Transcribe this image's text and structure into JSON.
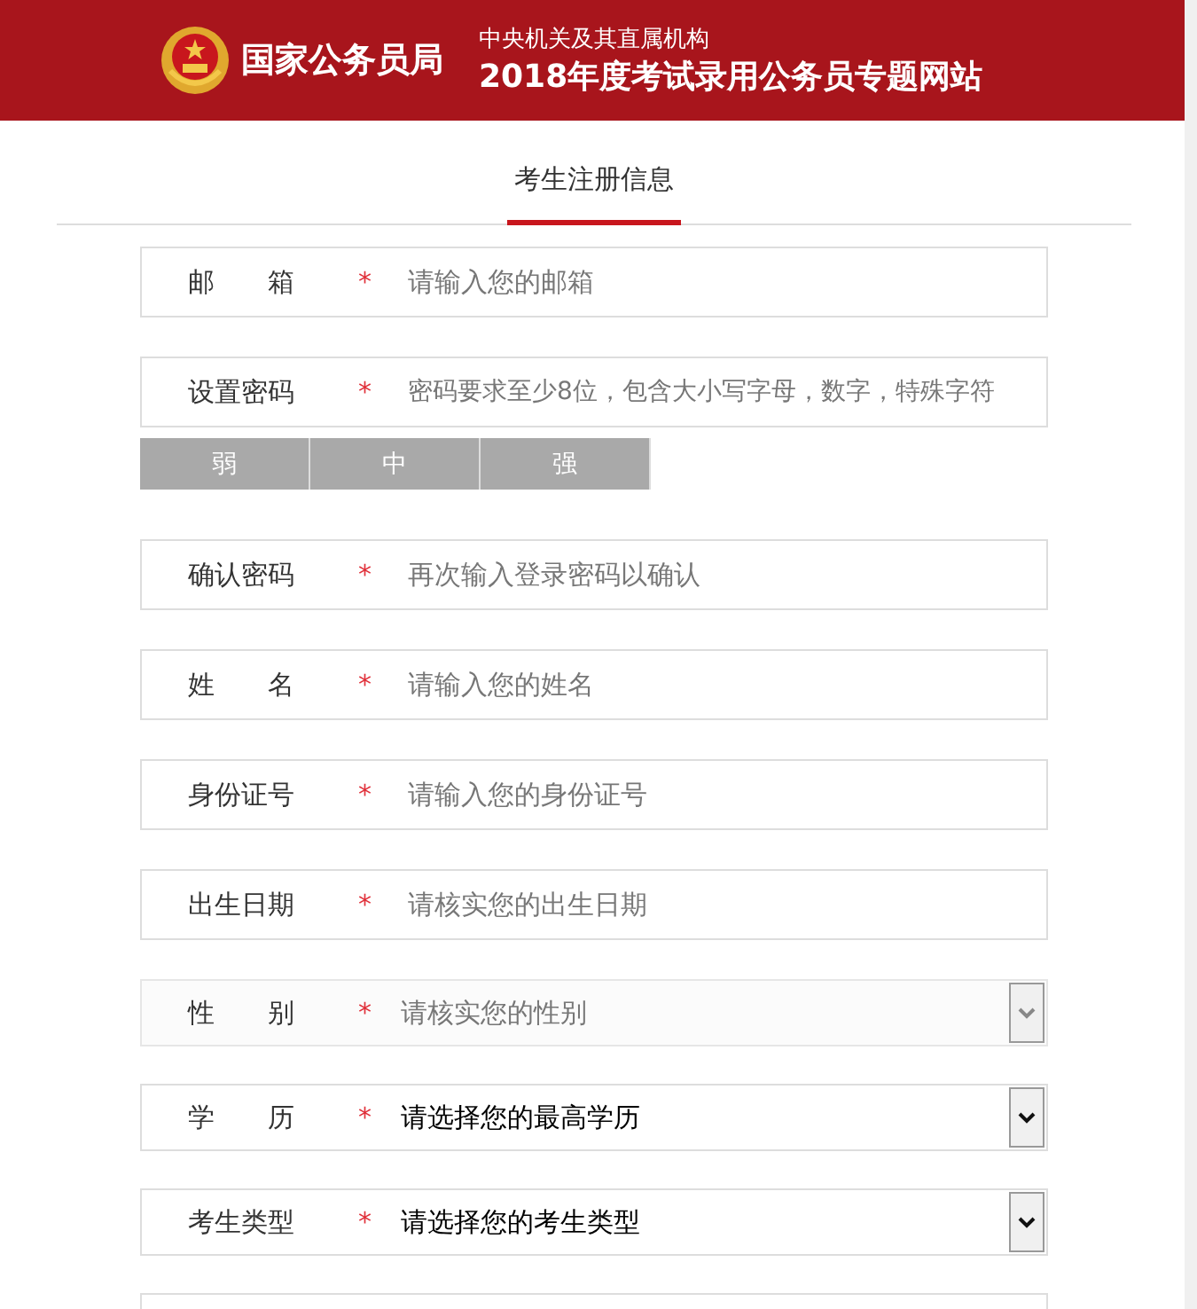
{
  "header": {
    "org_name": "国家公务员局",
    "subtitle": "中央机关及其直属机构",
    "title": "2018年度考试录用公务员专题网站"
  },
  "tabs": [
    {
      "label": "考生注册信息",
      "selected": true
    }
  ],
  "fields": [
    {
      "kind": "input",
      "label": "邮　　箱",
      "required_mark": "*",
      "placeholder": "请输入您的邮箱"
    },
    {
      "kind": "input",
      "label": "设置密码",
      "required_mark": "*",
      "placeholder": "密码要求至少8位，包含大小写字母，数字，特殊字符",
      "strength": [
        {
          "label": "弱",
          "selected": false
        },
        {
          "label": "中",
          "selected": false
        },
        {
          "label": "强",
          "selected": false
        }
      ]
    },
    {
      "kind": "input",
      "label": "确认密码",
      "required_mark": "*",
      "placeholder": "再次输入登录密码以确认"
    },
    {
      "kind": "input",
      "label": "姓　　名",
      "required_mark": "*",
      "placeholder": "请输入您的姓名"
    },
    {
      "kind": "input",
      "label": "身份证号",
      "required_mark": "*",
      "placeholder": "请输入您的身份证号"
    },
    {
      "kind": "input",
      "label": "出生日期",
      "required_mark": "*",
      "placeholder": "请核实您的出生日期"
    },
    {
      "kind": "select",
      "label": "性　　别",
      "required_mark": "*",
      "value": "请核实您的性别",
      "disabled": true
    },
    {
      "kind": "select",
      "label": "学　　历",
      "required_mark": "*",
      "value": "请选择您的最高学历",
      "disabled": false
    },
    {
      "kind": "select",
      "label": "考生类型",
      "required_mark": "*",
      "value": "请选择您的考生类型",
      "disabled": false
    },
    {
      "kind": "input"
    }
  ]
}
